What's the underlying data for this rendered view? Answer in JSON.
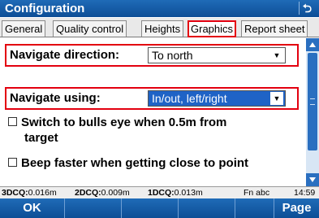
{
  "window": {
    "title": "Configuration",
    "back_icon": "back-arrow-icon"
  },
  "tabs": [
    {
      "label": "General",
      "active": false
    },
    {
      "label": "Quality control",
      "active": false
    },
    {
      "label": "Heights",
      "active": false
    },
    {
      "label": "Graphics",
      "active": true
    },
    {
      "label": "Report sheet",
      "active": false
    }
  ],
  "settings": {
    "navigate_direction": {
      "label": "Navigate direction:",
      "value": "To north"
    },
    "navigate_using": {
      "label": "Navigate using:",
      "value": "In/out, left/right"
    },
    "bulls_eye": {
      "label_line1": "Switch to bulls eye when 0.5m from",
      "label_line2": "target",
      "checked": false
    },
    "beep_faster": {
      "label": "Beep faster when getting close to point",
      "checked": false
    }
  },
  "status": {
    "q3d_label": "3DCQ:",
    "q3d_value": "0.016m",
    "q2d_label": "2DCQ:",
    "q2d_value": "0.009m",
    "q1d_label": "1DCQ:",
    "q1d_value": "0.013m",
    "keys": "Fn abc",
    "time": "14:59"
  },
  "softkeys": {
    "ok": "OK",
    "page": "Page"
  },
  "colors": {
    "accent": "#0d4e96",
    "highlight": "#e3000f",
    "selection": "#1f63c6"
  }
}
